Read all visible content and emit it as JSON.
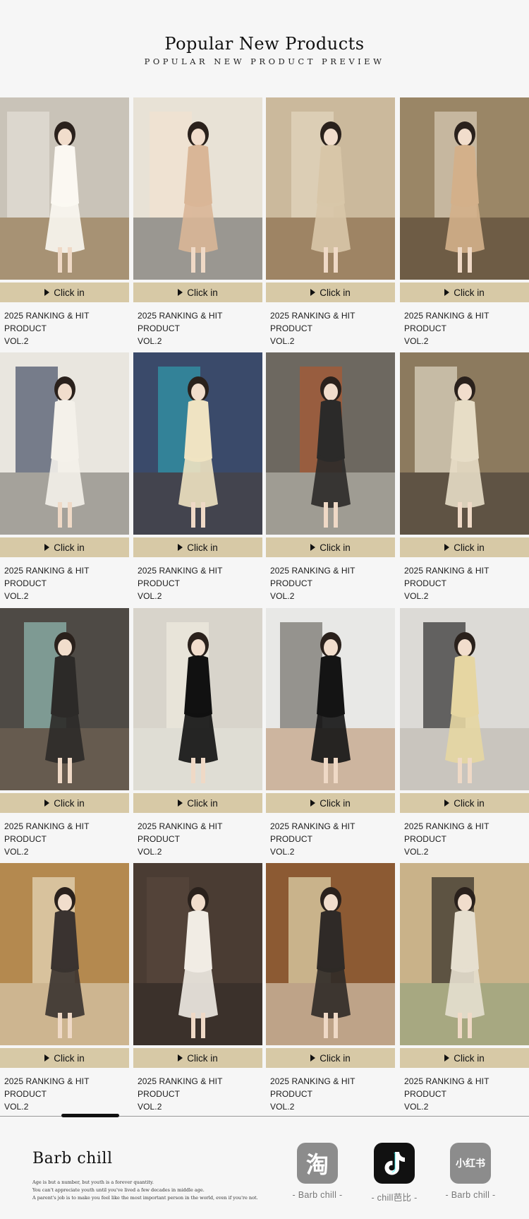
{
  "header": {
    "title": "Popular New Products",
    "subtitle": "POPULAR NEW PRODUCT PREVIEW"
  },
  "products": [
    {
      "button": "Click in",
      "caption_line1": "2025 RANKING & HIT PRODUCT",
      "caption_line2": "VOL.2"
    },
    {
      "button": "Click in",
      "caption_line1": "2025 RANKING & HIT PRODUCT",
      "caption_line2": "VOL.2"
    },
    {
      "button": "Click in",
      "caption_line1": "2025 RANKING & HIT PRODUCT",
      "caption_line2": "VOL.2"
    },
    {
      "button": "Click in",
      "caption_line1": "2025 RANKING & HIT PRODUCT",
      "caption_line2": "VOL.2"
    },
    {
      "button": "Click in",
      "caption_line1": "2025 RANKING & HIT PRODUCT",
      "caption_line2": "VOL.2"
    },
    {
      "button": "Click in",
      "caption_line1": "2025 RANKING & HIT PRODUCT",
      "caption_line2": "VOL.2"
    },
    {
      "button": "Click in",
      "caption_line1": "2025 RANKING & HIT PRODUCT",
      "caption_line2": "VOL.2"
    },
    {
      "button": "Click in",
      "caption_line1": "2025 RANKING & HIT PRODUCT",
      "caption_line2": "VOL.2"
    },
    {
      "button": "Click in",
      "caption_line1": "2025 RANKING & HIT PRODUCT",
      "caption_line2": "VOL.2"
    },
    {
      "button": "Click in",
      "caption_line1": "2025 RANKING & HIT PRODUCT",
      "caption_line2": "VOL.2"
    },
    {
      "button": "Click in",
      "caption_line1": "2025 RANKING & HIT PRODUCT",
      "caption_line2": "VOL.2"
    },
    {
      "button": "Click in",
      "caption_line1": "2025 RANKING & HIT PRODUCT",
      "caption_line2": "VOL.2"
    },
    {
      "button": "Click in",
      "caption_line1": "2025 RANKING & HIT PRODUCT",
      "caption_line2": "VOL.2"
    },
    {
      "button": "Click in",
      "caption_line1": "2025 RANKING & HIT PRODUCT",
      "caption_line2": "VOL.2"
    },
    {
      "button": "Click in",
      "caption_line1": "2025 RANKING & HIT PRODUCT",
      "caption_line2": "VOL.2"
    },
    {
      "button": "Click in",
      "caption_line1": "2025 RANKING & HIT PRODUCT",
      "caption_line2": "VOL.2"
    }
  ],
  "footer": {
    "brand": "Barb chill",
    "tagline": [
      "Age is but a number, but youth is a forever quantity.",
      "You can't appreciate youth until you've lived a few decades in middle age.",
      "A parent's job is to make you feel like the most important person in the world, even if you're not."
    ],
    "social": [
      {
        "icon": "taobao-icon",
        "glyph": "淘",
        "color": "#8c8c8c",
        "label": "- Barb chill -"
      },
      {
        "icon": "tiktok-icon",
        "glyph": "",
        "color": "#111111",
        "label": "- chill芭比 -"
      },
      {
        "icon": "xiaohongshu-icon",
        "glyph": "小红书",
        "color": "#8c8c8c",
        "label": "- Barb chill -"
      }
    ]
  }
}
